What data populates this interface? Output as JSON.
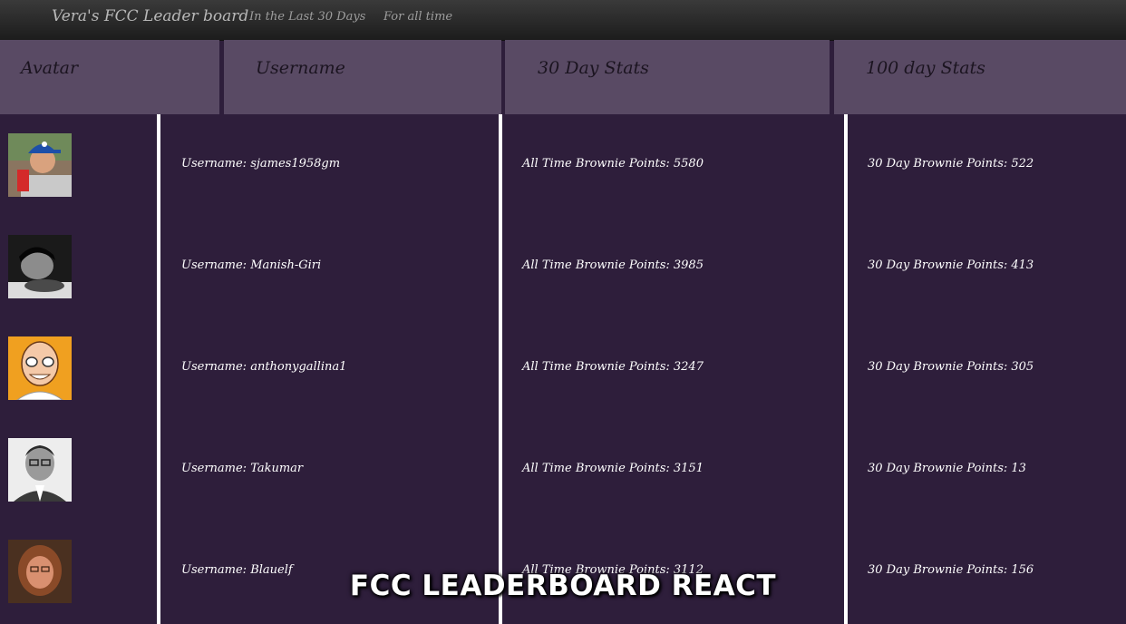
{
  "navbar": {
    "brand": "Vera's FCC Leader board",
    "links": [
      {
        "label": "In the Last 30 Days"
      },
      {
        "label": "For all time"
      }
    ]
  },
  "table": {
    "headers": [
      "Avatar",
      "Username",
      "30 Day Stats",
      "100 day Stats"
    ],
    "rows": [
      {
        "username": "Username: sjames1958gm",
        "all_time": "All Time Brownie Points: 5580",
        "thirty_day": "30 Day Brownie Points: 522"
      },
      {
        "username": "Username: Manish-Giri",
        "all_time": "All Time Brownie Points: 3985",
        "thirty_day": "30 Day Brownie Points: 413"
      },
      {
        "username": "Username: anthonygallina1",
        "all_time": "All Time Brownie Points: 3247",
        "thirty_day": "30 Day Brownie Points: 305"
      },
      {
        "username": "Username: Takumar",
        "all_time": "All Time Brownie Points: 3151",
        "thirty_day": "30 Day Brownie Points: 13"
      },
      {
        "username": "Username: Blauelf",
        "all_time": "All Time Brownie Points: 3112",
        "thirty_day": "30 Day Brownie Points: 156"
      }
    ]
  },
  "caption": "FCC LEADERBOARD REACT",
  "colors": {
    "background": "#2e1e3b",
    "header": "#594a64",
    "navbar": "#222222",
    "divider": "#ffffff"
  }
}
